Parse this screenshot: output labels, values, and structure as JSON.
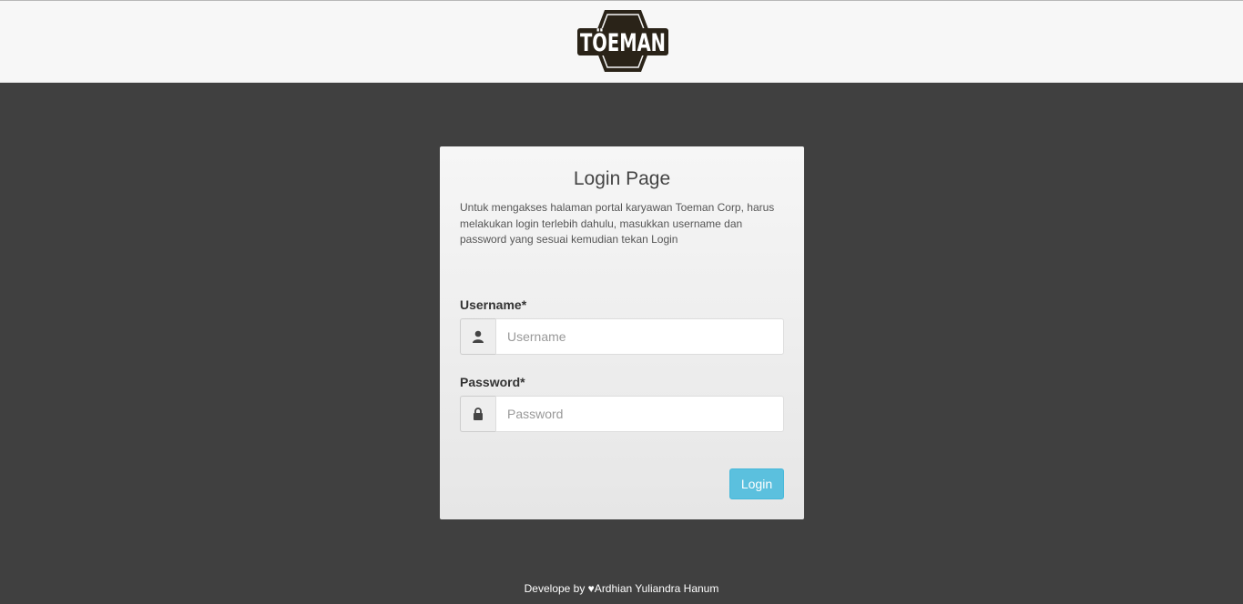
{
  "header": {
    "logo_text": "TÖEMAN"
  },
  "login": {
    "title": "Login Page",
    "description": "Untuk mengakses halaman portal karyawan Toeman Corp, harus melakukan login terlebih dahulu, masukkan username dan password yang sesuai kemudian tekan Login",
    "username_label": "Username*",
    "username_placeholder": "Username",
    "username_icon": "user-icon",
    "password_label": "Password*",
    "password_placeholder": "Password",
    "password_icon": "lock-icon",
    "button_label": "Login"
  },
  "footer": {
    "text": "Develope by ♥Ardhian Yuliandra Hanum"
  },
  "colors": {
    "page_background": "#404040",
    "header_background": "#f7f7f7",
    "button_accent": "#5bc0de",
    "logo_dark": "#2a2318"
  }
}
